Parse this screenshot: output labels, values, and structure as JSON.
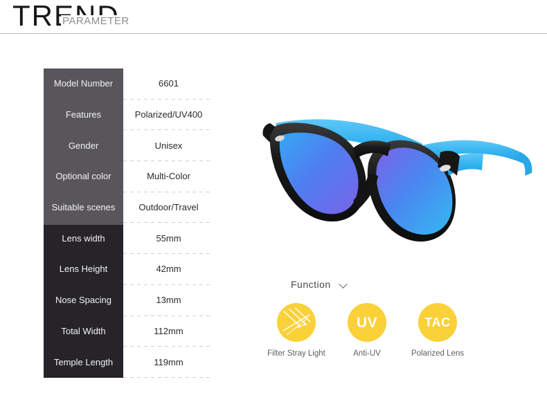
{
  "header": {
    "brand_main": "TREND",
    "brand_sub": "PARAMETER"
  },
  "spec_table": {
    "rows": [
      {
        "label": "Model Number",
        "value": "6601"
      },
      {
        "label": "Features",
        "value": "Polarized/UV400"
      },
      {
        "label": "Gender",
        "value": "Unisex"
      },
      {
        "label": "Optional color",
        "value": "Multi-Color"
      },
      {
        "label": "Suitable scenes",
        "value": "Outdoor/Travel"
      },
      {
        "label": "Lens width",
        "value": "55mm"
      },
      {
        "label": "Lens Height",
        "value": "42mm"
      },
      {
        "label": "Nose Spacing",
        "value": "13mm"
      },
      {
        "label": "Total Width",
        "value": "112mm"
      },
      {
        "label": "Temple Length",
        "value": "119mm"
      }
    ]
  },
  "product": {
    "name": "polarized-sunglasses",
    "frame_color": "#1b1b1b",
    "temple_color": "#3fb5f0",
    "lens_color_start": "#2f7df0",
    "lens_color_mid": "#6f62e0",
    "lens_color_end": "#3ec0f0"
  },
  "function": {
    "title": "Function",
    "chevron_icon": "chevron-down-icon",
    "accent_color": "#fad139",
    "items": [
      {
        "icon": "light-rays-icon",
        "glyph": "",
        "caption": "Filter Stray Light"
      },
      {
        "icon": "uv-icon",
        "glyph": "UV",
        "caption": "Anti-UV"
      },
      {
        "icon": "tac-icon",
        "glyph": "TAC",
        "caption": "Polarized Lens"
      }
    ]
  }
}
